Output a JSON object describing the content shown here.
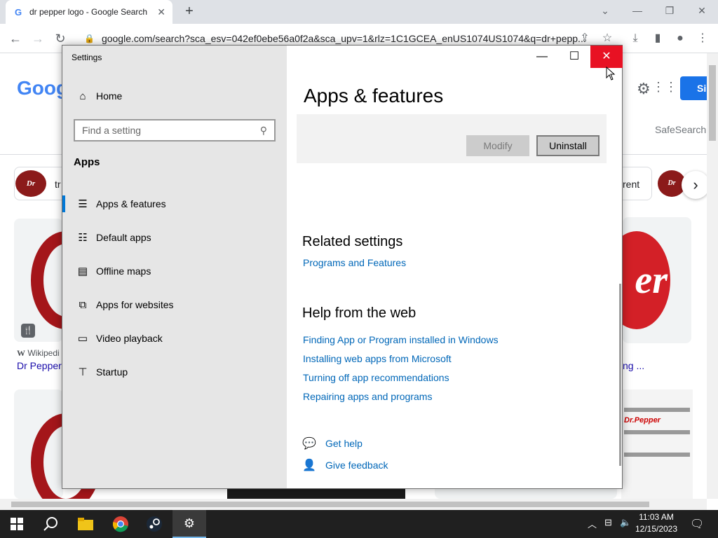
{
  "browser": {
    "tab_title": "dr pepper logo - Google Search",
    "tab_favicon": "G",
    "url": "google.com/search?sca_esv=042ef0ebe56a0f2a&sca_upv=1&rlz=1C1GCEA_enUS1074US1074&q=dr+pepp..."
  },
  "google": {
    "logo_text": "Goog",
    "sign_in": "Si",
    "safesearch": "SafeSearch",
    "chips": {
      "first_text": "tr",
      "last_text": "rent"
    },
    "results": {
      "source": "Wikipedi",
      "source_icon": "W",
      "title": "Dr Pepper",
      "right_title": "ng ..."
    }
  },
  "settings": {
    "window_title": "Settings",
    "home_label": "Home",
    "search_placeholder": "Find a setting",
    "section_heading": "Apps",
    "nav_items": [
      {
        "label": "Apps & features",
        "icon": "list-icon"
      },
      {
        "label": "Default apps",
        "icon": "default-apps-icon"
      },
      {
        "label": "Offline maps",
        "icon": "map-icon"
      },
      {
        "label": "Apps for websites",
        "icon": "link-icon"
      },
      {
        "label": "Video playback",
        "icon": "video-icon"
      },
      {
        "label": "Startup",
        "icon": "startup-icon"
      }
    ],
    "page_title": "Apps & features",
    "modify_label": "Modify",
    "uninstall_label": "Uninstall",
    "related_heading": "Related settings",
    "related_links": [
      "Programs and Features"
    ],
    "help_heading": "Help from the web",
    "help_links": [
      "Finding App or Program installed in Windows",
      "Installing web apps from Microsoft",
      "Turning off app recommendations",
      "Repairing apps and programs"
    ],
    "get_help": "Get help",
    "give_feedback": "Give feedback"
  },
  "taskbar": {
    "time": "11:03 AM",
    "date": "12/15/2023"
  },
  "colors": {
    "accent": "#0078d7",
    "link": "#0067b8",
    "close_hover": "#e81123"
  }
}
